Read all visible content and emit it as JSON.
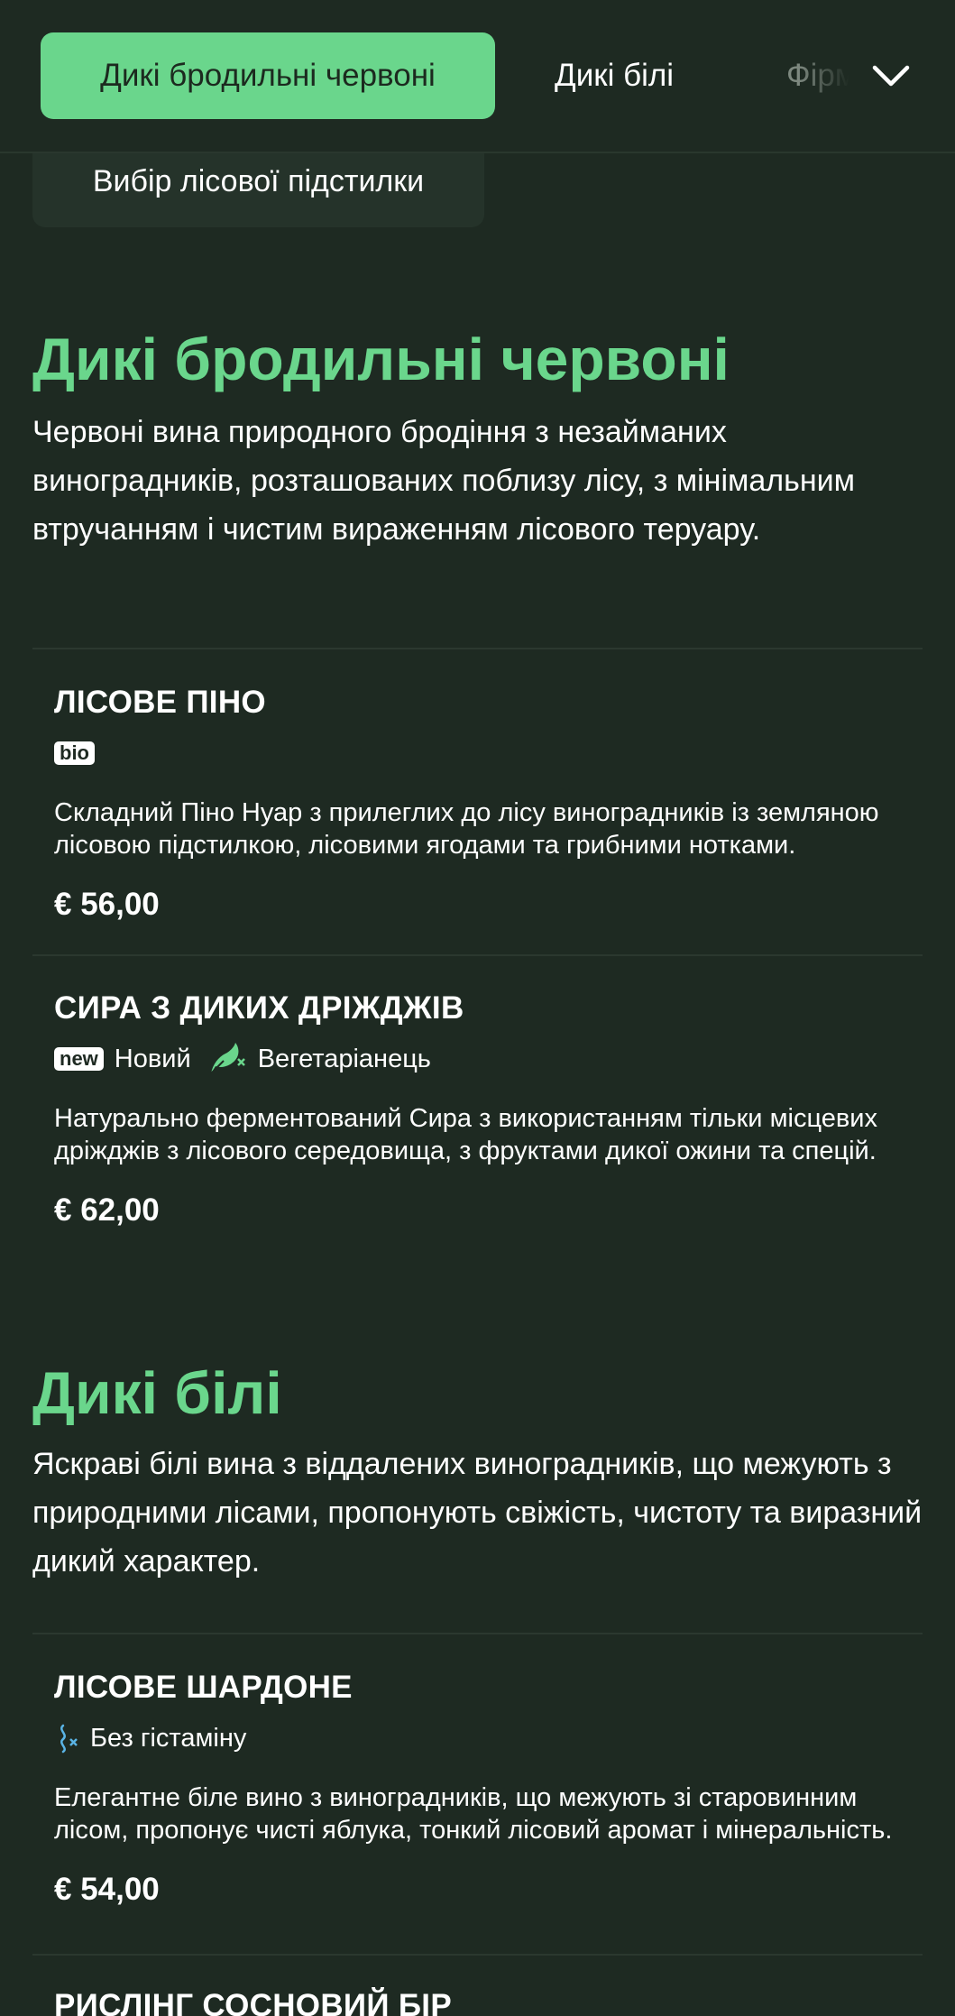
{
  "categories": {
    "active": "Дикі бродильні червоні",
    "second": "Дикі білі",
    "third_partial": "Фірмові",
    "expand_icon": "chevron-down-icon"
  },
  "subcategory": {
    "label": "Вибір лісової підстилки"
  },
  "sections": [
    {
      "title": "Дикі бродильні червоні",
      "description": "Червоні вина природного бродіння з незайманих виноградників, розташованих поблизу лісу, з мінімальним втручанням і чистим вираженням лісового теруару.",
      "items": [
        {
          "name": "ЛІСОВЕ ПІНО",
          "badge": "bio",
          "description": "Складний Піно Нуар з прилеглих до лісу виноградників із земляною лісовою підстилкою, лісовими ягодами та грибними нотками.",
          "price": "€ 56,00"
        },
        {
          "name": "СИРА З ДИКИХ ДРІЖДЖІВ",
          "badge": "new",
          "badge_label": "Новий",
          "diet_icon": "vegetarian-icon",
          "diet_label": "Вегетаріанець",
          "description": "Натурально ферментований Сира з використанням тільки місцевих дріжджів з лісового середовища, з фруктами дикої ожини та спецій.",
          "price": "€ 62,00"
        }
      ]
    },
    {
      "title": "Дикі білі",
      "description": "Яскраві білі вина з віддалених виноградників, що межують з природними лісами, пропонують свіжість, чистоту та виразний дикий характер.",
      "items": [
        {
          "name": "ЛІСОВЕ ШАРДОНЕ",
          "diet_icon": "histamine-free-icon",
          "diet_label": "Без гістаміну",
          "description": "Елегантне біле вино з виноградників, що межують зі старовинним лісом, пропонує чисті яблука, тонкий лісовий аромат і мінеральність.",
          "price": "€ 54,00"
        },
        {
          "name": "РИСЛІНГ СОСНОВИЙ БІР"
        }
      ]
    }
  ],
  "colors": {
    "background": "#1e2a22",
    "accent": "#6ad68c",
    "pill": "#25332a",
    "divider": "#2b382f"
  }
}
